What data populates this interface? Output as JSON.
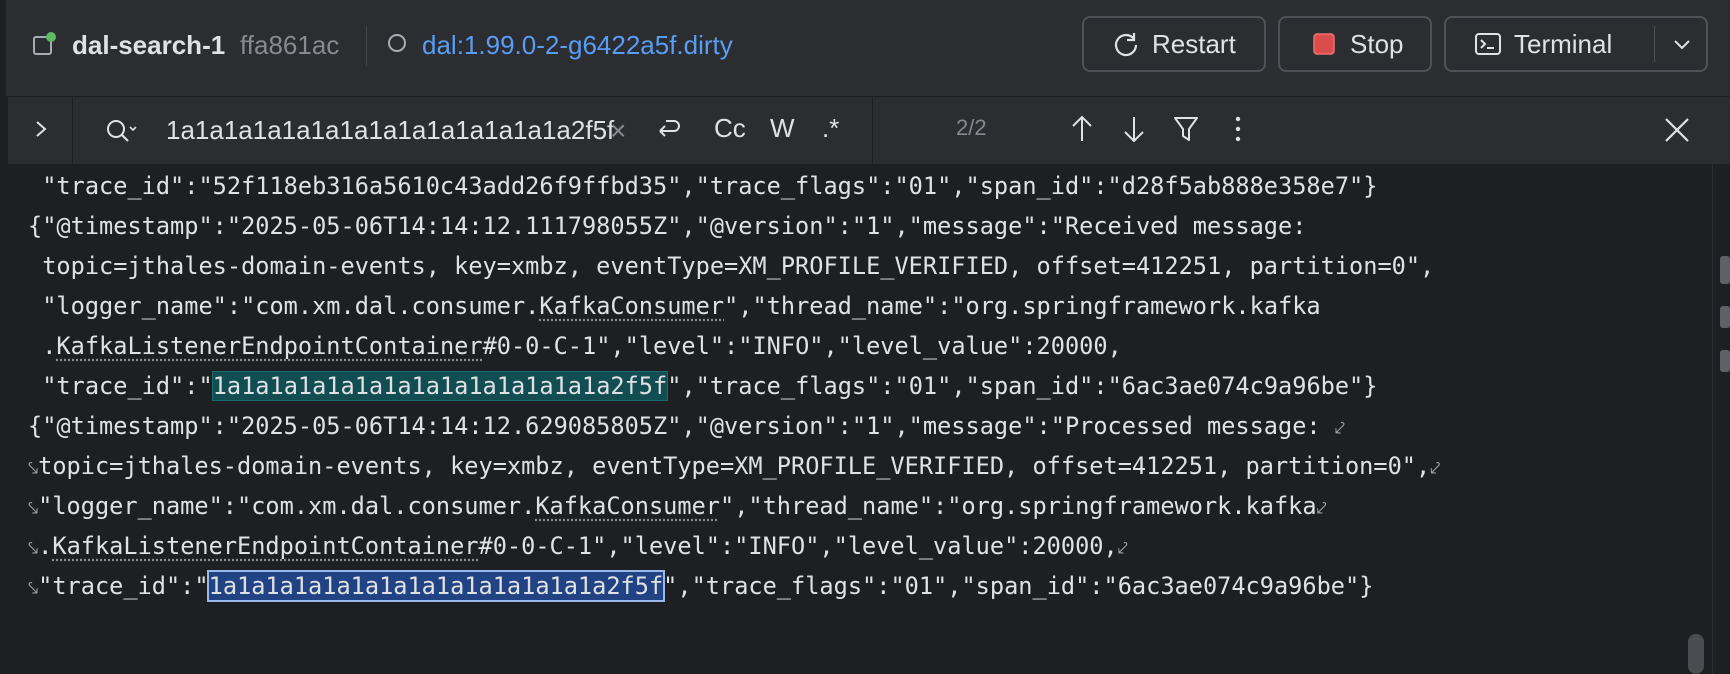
{
  "header": {
    "container_name": "dal-search-1",
    "container_hash": "ffa861ac",
    "image_name": "dal:1.99.0-2-g6422a5f.dirty",
    "restart_label": "Restart",
    "stop_label": "Stop",
    "terminal_label": "Terminal",
    "status_color": "#5fb865",
    "stop_color": "#e05555"
  },
  "search": {
    "query": "1a1a1a1a1a1a1a1a1a1a1a1a1a1a2f5f",
    "clear_symbol": "×",
    "match_case_label": "Cc",
    "words_label": "W",
    "regex_label": ".*",
    "match_count": "2/2"
  },
  "log": {
    "line1_trace": " \"trace_id\":\"52f118eb316a5610c43add26f9ffbd35\",\"trace_flags\":\"01\",\"span_id\":\"d28f5ab888e358e7\"}",
    "e1_line1": "{\"@timestamp\":\"2025-05-06T14:14:12.111798055Z\",\"@version\":\"1\",\"message\":\"Received message:",
    "e1_line2": " topic=jthales-domain-events, key=xmbz, eventType=XM_PROFILE_VERIFIED, offset=412251, partition=0\",",
    "e1_line3a": " \"logger_name\":\"com.xm.dal.consumer.",
    "e1_line3b": "KafkaConsumer",
    "e1_line3c": "\",\"thread_name\":\"org.springframework.kafka",
    "e1_line4a": " .",
    "e1_line4b": "KafkaListenerEndpointContainer",
    "e1_line4c": "#0-0-C-1\",\"level\":\"INFO\",\"level_value\":20000,",
    "e1_line5a": " \"trace_id\":\"",
    "e1_line5b": "1a1a1a1a1a1a1a1a1a1a1a1a1a1a2f5f",
    "e1_line5c": "\",\"trace_flags\":\"01\",\"span_id\":\"6ac3ae074c9a96be\"}",
    "e2_line1": "{\"@timestamp\":\"2025-05-06T14:14:12.629085805Z\",\"@version\":\"1\",\"message\":\"Processed message: ",
    "e2_line2": "topic=jthales-domain-events, key=xmbz, eventType=XM_PROFILE_VERIFIED, offset=412251, partition=0\",",
    "e2_line3a": "\"logger_name\":\"com.xm.dal.consumer.",
    "e2_line3b": "KafkaConsumer",
    "e2_line3c": "\",\"thread_name\":\"org.springframework.kafka",
    "e2_line4a": ".",
    "e2_line4b": "KafkaListenerEndpointContainer",
    "e2_line4c": "#0-0-C-1\",\"level\":\"INFO\",\"level_value\":20000,",
    "e2_line5a": "\"trace_id\":\"",
    "e2_line5b": "1a1a1a1a1a1a1a1a1a1a1a1a1a1a2f5f",
    "e2_line5c": "\",\"trace_flags\":\"01\",\"span_id\":\"6ac3ae074c9a96be\"}",
    "wrap_end": "⤦",
    "wrap_start": "⤥"
  }
}
